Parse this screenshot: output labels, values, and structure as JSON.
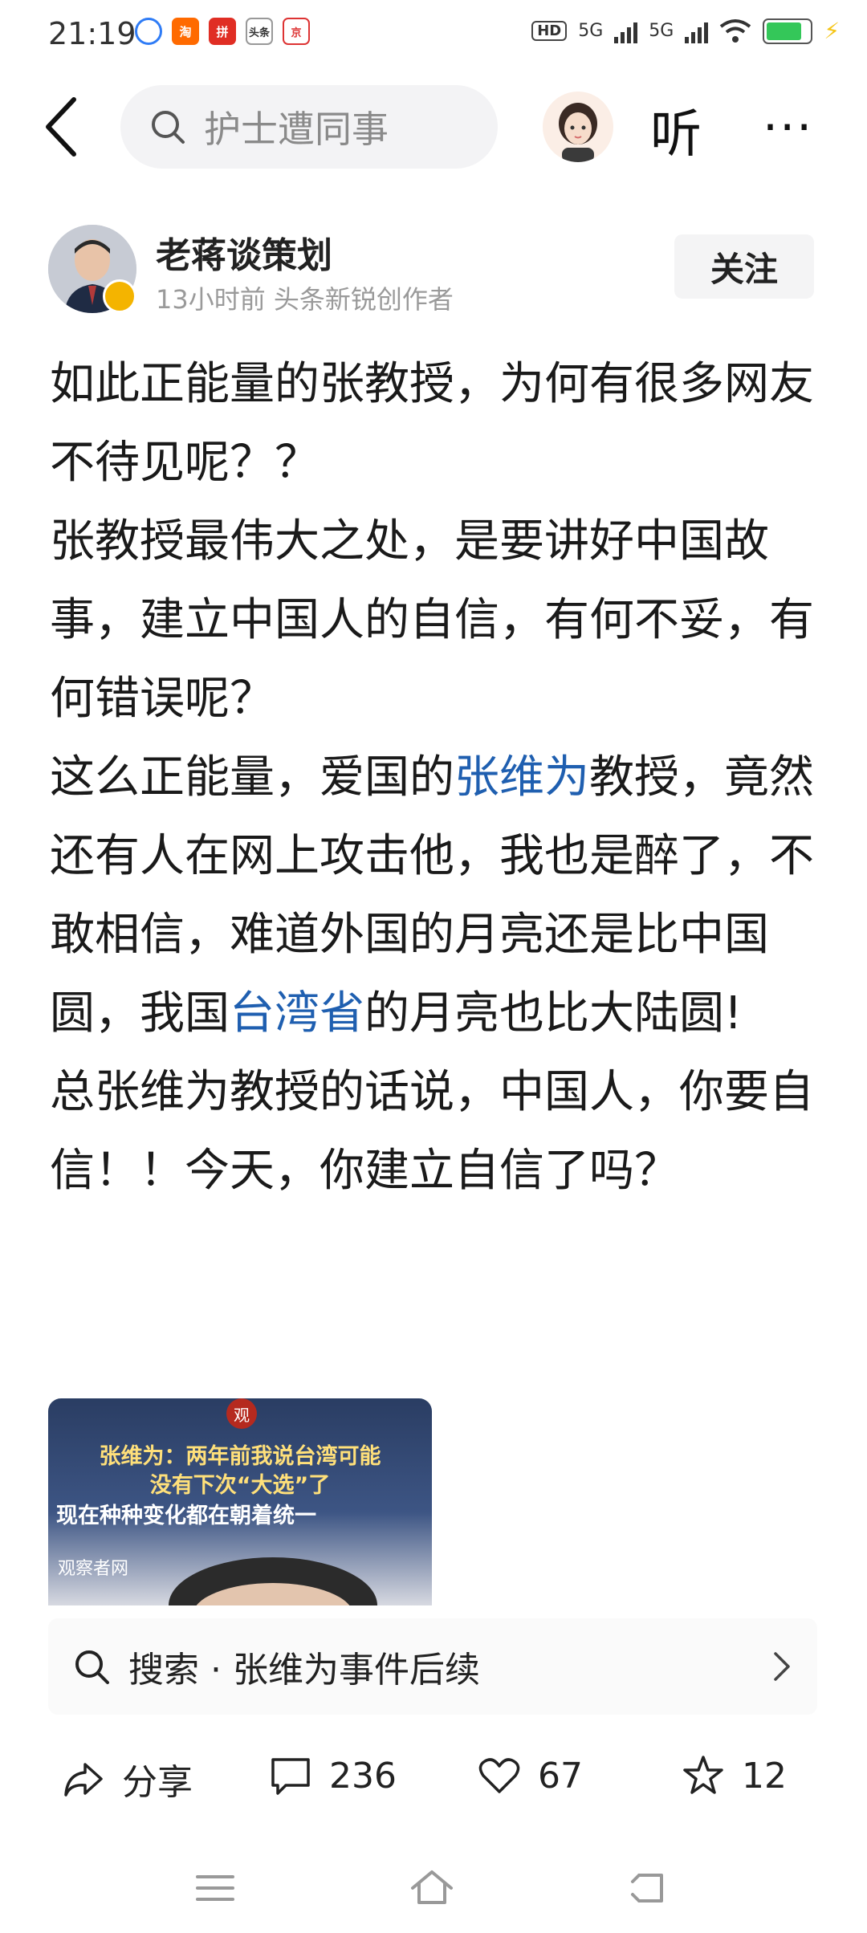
{
  "status_bar": {
    "time": "21:19",
    "app_icons": [
      "browser",
      "淘",
      "拼",
      "头条",
      "京东"
    ],
    "hd_label": "HD",
    "net1": "5G",
    "net2": "5G",
    "battery_level": 0.85,
    "charging": true
  },
  "nav": {
    "search_placeholder": "护士遭同事",
    "listen_label": "听",
    "more_label": "···"
  },
  "author": {
    "name": "老蒋谈策划",
    "meta": "13小时前  头条新锐创作者",
    "follow_label": "关注"
  },
  "article": {
    "p1": "如此正能量的张教授，为何有很多网友不待见呢？？",
    "p2": "张教授最伟大之处，是要讲好中国故事，建立中国人的自信，有何不妥，有何错误呢？",
    "p3_a": "这么正能量，爱国的",
    "p3_link": "张维为",
    "p3_b": "教授，竟然还有人在网上攻击他，我也是醉了，不敢相信，难道外国的月亮还是比中国圆，我国",
    "p3_link2": "台湾省",
    "p3_c": "的月亮也比大陆圆!",
    "p4": "总张维为教授的话说，中国人，你要自信！！今天，你建立自信了吗？"
  },
  "video": {
    "seal": "观",
    "line1": "张维为：两年前我说台湾可能",
    "line2": "没有下次“大选”了",
    "line3": "现在种种变化都在朝着统一",
    "source": "观察者网"
  },
  "related_search": {
    "text": "搜索 · 张维为事件后续"
  },
  "actions": {
    "share": "分享",
    "comments": "236",
    "likes": "67",
    "favorites": "12"
  }
}
